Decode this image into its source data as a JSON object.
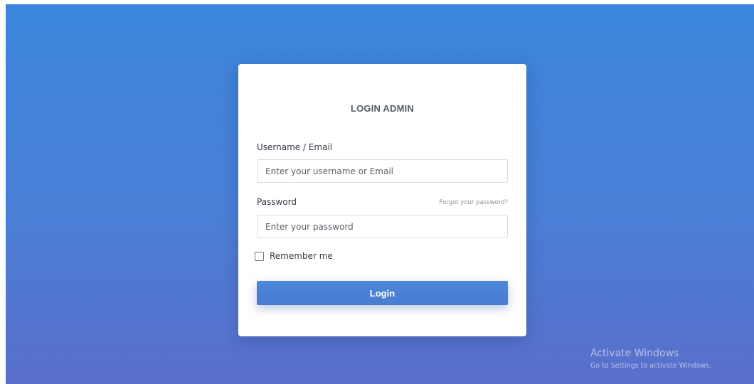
{
  "login": {
    "title": "LOGIN ADMIN",
    "username_label": "Username / Email",
    "username_placeholder": "Enter your username or Email",
    "password_label": "Password",
    "forgot_link": "Forgot your password?",
    "password_placeholder": "Enter your password",
    "remember_label": "Remember me",
    "remember_checked": false,
    "submit_label": "Login"
  },
  "watermark": {
    "title": "Activate Windows",
    "subtitle": "Go to Settings to activate Windows."
  },
  "colors": {
    "background_top": "#3b86dc",
    "background_bottom": "#5a6fcb",
    "button": "#4a80d5",
    "card": "#ffffff"
  }
}
